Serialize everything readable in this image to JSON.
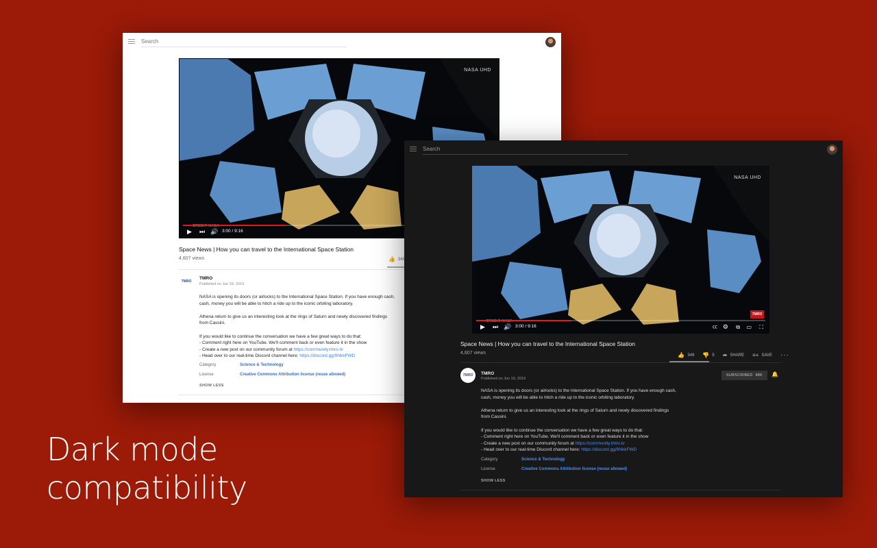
{
  "tagline": {
    "line1": "Dark mode",
    "line2": "compatibility"
  },
  "video": {
    "title": "Space News | How you can travel to the International Space Station",
    "views": "4,607 views",
    "time": "3:00 / 9:16",
    "progress": 0.33,
    "badge": "NASA UHD",
    "credit": "CREDIT NASA",
    "likes": "349",
    "dislikes": "5",
    "share_label": "SHARE",
    "save_label": "SAVE"
  },
  "channel": {
    "name": "TMRO",
    "published": "Published on Jun 19, 2019",
    "logo_text": "TMRO",
    "subscribed_label": "SUBSCRIBED",
    "subscriber_count": "48K"
  },
  "description": {
    "p1_l1": "NASA is opening its doors (or airlocks) to the International Space Station. If you have enough cash,",
    "p1_l2": "cash, money you will be able to hitch a ride up to the iconic orbiting laboratory.",
    "p2_l1": "Athena return to give us an interesting look at the rings of Saturn and newly discovered findings",
    "p2_l2": "from Cassini.",
    "p3_l1": "If you would like to continue the conversation we have a few great ways to do that:",
    "p3_l2": "- Comment right here on YouTube. We'll comment back or even feature it in the show",
    "p3_l3_prefix": "- Create a new post on our community forum at ",
    "p3_l3_link": "https://community.tmro.tv",
    "p3_l4_prefix": "- Head over to our real-time Discord channel here: ",
    "p3_l4_link": "https://discord.gg/9NkkFWD",
    "category_label": "Category",
    "category_value": "Science & Technology",
    "license_label": "License",
    "license_value": "Creative Commons Attribution license (reuse allowed)",
    "show_less": "SHOW LESS"
  },
  "search": {
    "placeholder": "Search"
  },
  "colors": {
    "background": "#9b1a08",
    "progress": "#e21b1b",
    "link": "#3e82e6",
    "dark_bg": "#181818"
  }
}
